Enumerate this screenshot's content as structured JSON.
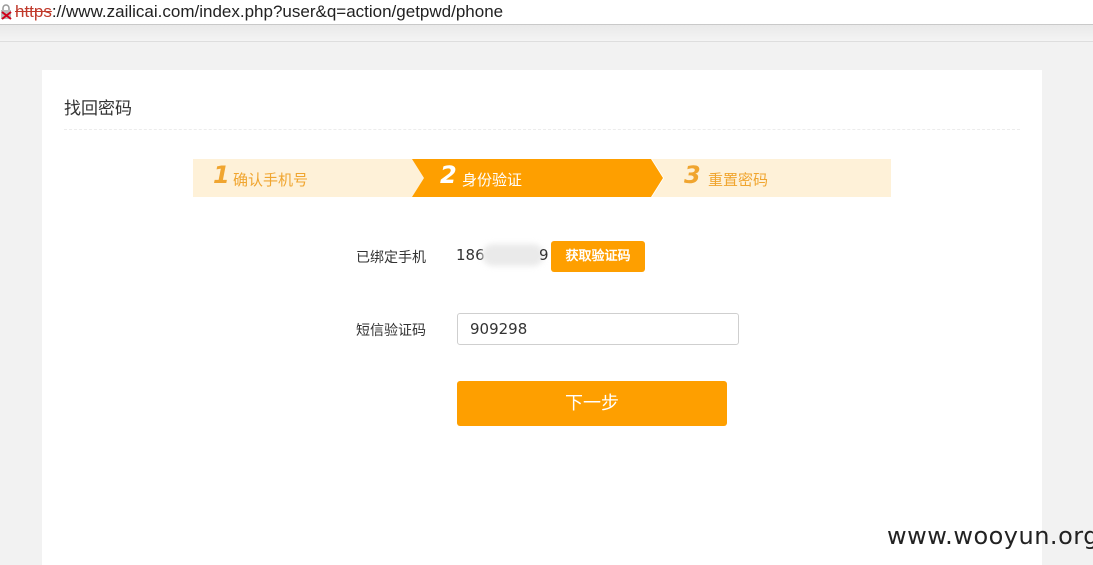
{
  "browser": {
    "url_scheme": "https",
    "url_rest": "://www.zailicai.com/index.php?user&q=action/getpwd/phone"
  },
  "page": {
    "title": "找回密码",
    "accent_color": "#fe9f00",
    "step_inactive_bg": "#fef1d8"
  },
  "steps": [
    {
      "number": "1",
      "label": "确认手机号",
      "active": false
    },
    {
      "number": "2",
      "label": "身份验证",
      "active": true
    },
    {
      "number": "3",
      "label": "重置密码",
      "active": false
    }
  ],
  "form": {
    "bound_phone_label": "已绑定手机",
    "phone_prefix": "186",
    "phone_suffix": "9",
    "get_code_button": "获取验证码",
    "sms_code_label": "短信验证码",
    "sms_code_value": "909298",
    "next_button": "下一步"
  },
  "watermark": "www.wooyun.org"
}
